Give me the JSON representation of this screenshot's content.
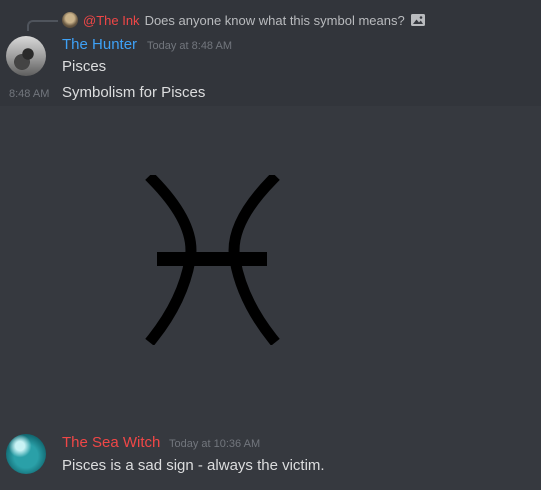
{
  "reply": {
    "mention": "@The Ink",
    "text": "Does anyone know what this symbol means?",
    "attachment_icon": "image-icon"
  },
  "messages": [
    {
      "username": "The Hunter",
      "username_color": "#3ea1f6",
      "timestamp": "Today at 8:48 AM",
      "lines": [
        {
          "text": "Pisces"
        },
        {
          "side_time": "8:48 AM",
          "text": "Symbolism for Pisces"
        }
      ],
      "attachment": {
        "type": "image",
        "icon": "pisces-symbol-icon"
      }
    },
    {
      "username": "The Sea Witch",
      "username_color": "#f04747",
      "timestamp": "Today at 10:36 AM",
      "lines": [
        {
          "text": "Pisces is a sad sign - always the victim."
        }
      ]
    }
  ],
  "colors": {
    "background": "#36393f",
    "hover_background": "#32353b",
    "mention": "#f04747",
    "timestamp": "#72767d",
    "text": "#dcddde"
  }
}
